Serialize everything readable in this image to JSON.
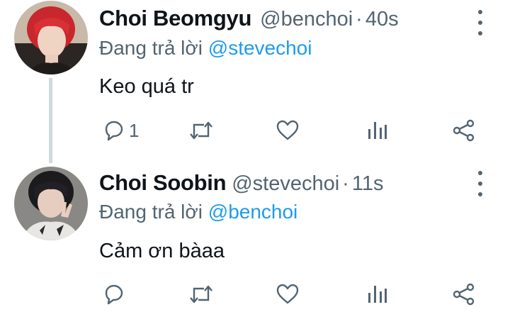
{
  "tweets": [
    {
      "name": "Choi Beomgyu",
      "handle": "@benchoi",
      "separator": "·",
      "time": "40s",
      "replying_prefix": "Đang trả lời",
      "replying_to": "@stevechoi",
      "text": "Keo quá tr",
      "reply_count": "1",
      "avatar_description": "red-haired profile photo"
    },
    {
      "name": "Choi Soobin",
      "handle": "@stevechoi",
      "separator": "·",
      "time": "11s",
      "replying_prefix": "Đang trả lời",
      "replying_to": "@benchoi",
      "text": "Cảm ơn bàaa",
      "reply_count": "",
      "avatar_description": "dark-haired profile photo with peace sign"
    }
  ],
  "actions": [
    "reply-icon",
    "retweet-icon",
    "like-icon",
    "analytics-icon",
    "share-icon"
  ],
  "colors": {
    "text": "#0f1419",
    "secondary": "#536471",
    "link": "#1d9bf0",
    "thread_line": "#cfd9de"
  }
}
